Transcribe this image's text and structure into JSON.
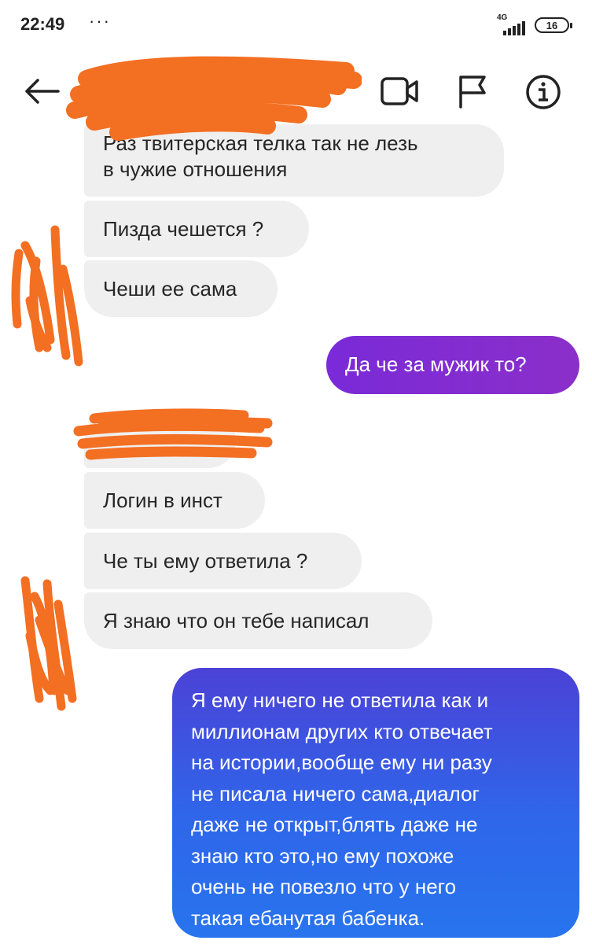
{
  "status_bar": {
    "time": "22:49",
    "dots": "···",
    "network": "4G",
    "battery": "16"
  },
  "header": {
    "back_icon": "arrow-left",
    "contact_name": ".",
    "icons": [
      "video-camera",
      "flag",
      "info-circle"
    ]
  },
  "messages": [
    {
      "direction": "in",
      "text_lines": [
        "Раз твитерская телка так не лезь",
        "в чужие отношения"
      ]
    },
    {
      "direction": "in",
      "text": "Пизда чешется ?"
    },
    {
      "direction": "in",
      "text": "Чеши ее сама"
    },
    {
      "direction": "out",
      "text": "Да че за мужик то?"
    },
    {
      "direction": "in",
      "text": "Логин в инст"
    },
    {
      "direction": "in",
      "text": "Че ты ему ответила ?"
    },
    {
      "direction": "in",
      "text": "Я знаю что он тебе написал"
    },
    {
      "direction": "out",
      "text_lines": [
        "Я ему ничего не ответила как и",
        "миллионам других кто отвечает",
        "на истории,вообще ему ни разу",
        "не писала ничего сама,диалог",
        "даже не открыт,блять даже не",
        "знаю кто это,но ему похоже",
        "очень не повезло что у него",
        "такая ебанутая бабенка."
      ]
    }
  ],
  "colors": {
    "incoming_bubble": "#efefef",
    "outgoing_purple": "#7a2ad8",
    "outgoing_blue": "#2f66ea",
    "redaction_scribble": "#f36f22"
  }
}
